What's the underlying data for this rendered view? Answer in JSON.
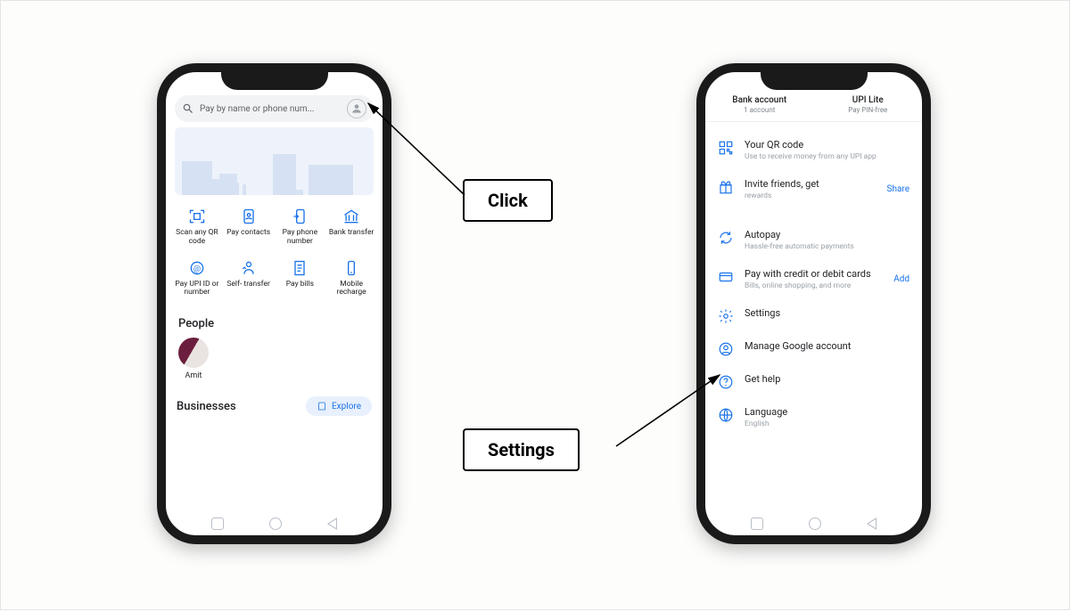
{
  "callouts": {
    "click": "Click",
    "settings": "Settings"
  },
  "home": {
    "search_placeholder": "Pay by name or phone num...",
    "actions": [
      {
        "label": "Scan any QR code"
      },
      {
        "label": "Pay contacts"
      },
      {
        "label": "Pay phone number"
      },
      {
        "label": "Bank transfer"
      },
      {
        "label": "Pay UPI ID or number"
      },
      {
        "label": "Self- transfer"
      },
      {
        "label": "Pay bills"
      },
      {
        "label": "Mobile recharge"
      }
    ],
    "people_heading": "People",
    "people": [
      {
        "name": "Amit"
      }
    ],
    "businesses_heading": "Businesses",
    "explore_label": "Explore"
  },
  "profile": {
    "tabs": [
      {
        "title": "Bank account",
        "sub": "1 account"
      },
      {
        "title": "UPI Lite",
        "sub": "Pay PIN-free"
      }
    ],
    "rows": {
      "qr": {
        "title": "Your QR code",
        "sub": "Use to receive money from any UPI app"
      },
      "invite": {
        "title": "Invite friends, get",
        "sub": "rewards",
        "action": "Share"
      },
      "autopay": {
        "title": "Autopay",
        "sub": "Hassle-free automatic payments"
      },
      "cards": {
        "title": "Pay with credit or debit cards",
        "sub": "Bills, online shopping, and more",
        "action": "Add"
      },
      "settings": {
        "title": "Settings"
      },
      "google": {
        "title": "Manage Google account"
      },
      "help": {
        "title": "Get help"
      },
      "language": {
        "title": "Language",
        "sub": "English"
      }
    }
  }
}
